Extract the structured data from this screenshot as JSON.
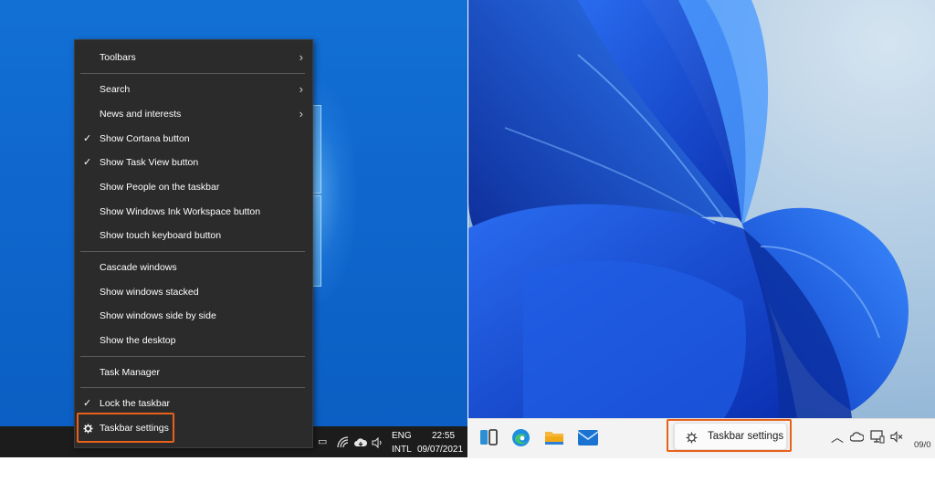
{
  "win10": {
    "context_menu": {
      "items": [
        {
          "label": "Toolbars",
          "checked": false,
          "submenu": true
        },
        {
          "label": "Search",
          "checked": false,
          "submenu": true
        },
        {
          "label": "News and interests",
          "checked": false,
          "submenu": true
        },
        {
          "label": "Show Cortana button",
          "checked": true,
          "submenu": false
        },
        {
          "label": "Show Task View button",
          "checked": true,
          "submenu": false
        },
        {
          "label": "Show People on the taskbar",
          "checked": false,
          "submenu": false
        },
        {
          "label": "Show Windows Ink Workspace button",
          "checked": false,
          "submenu": false
        },
        {
          "label": "Show touch keyboard button",
          "checked": false,
          "submenu": false
        },
        {
          "label": "Cascade windows",
          "checked": false,
          "submenu": false
        },
        {
          "label": "Show windows stacked",
          "checked": false,
          "submenu": false
        },
        {
          "label": "Show windows side by side",
          "checked": false,
          "submenu": false
        },
        {
          "label": "Show the desktop",
          "checked": false,
          "submenu": false
        },
        {
          "label": "Task Manager",
          "checked": false,
          "submenu": false
        },
        {
          "label": "Lock the taskbar",
          "checked": true,
          "submenu": false
        },
        {
          "label": "Taskbar settings",
          "checked": false,
          "submenu": false,
          "icon": "gear-icon"
        }
      ],
      "check_glyph": "✓",
      "arrow_glyph": "›"
    },
    "taskbar": {
      "language_line1": "ENG",
      "language_line2": "INTL",
      "time": "22:55",
      "date": "09/07/2021",
      "tray_icons": [
        "network-icon",
        "onedrive-icon",
        "volume-icon"
      ]
    },
    "highlight_color": "#e8611a"
  },
  "win11": {
    "taskbar": {
      "popup_label": "Taskbar settings",
      "pinned_icons": [
        "task-view-icon",
        "edge-icon",
        "file-explorer-icon",
        "mail-icon"
      ],
      "tray_icons": [
        "chevron-up-icon",
        "onedrive-icon",
        "network-icon",
        "mute-icon"
      ],
      "clock_partial": "09/0"
    },
    "highlight_color": "#e8611a"
  }
}
